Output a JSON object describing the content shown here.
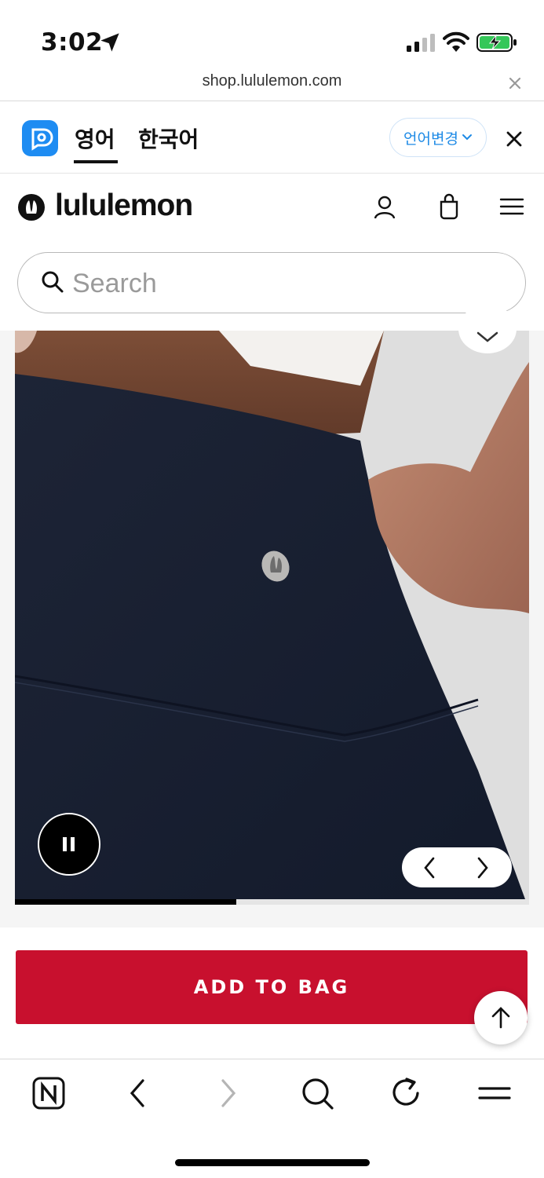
{
  "status_bar": {
    "time": "3:02"
  },
  "browser": {
    "url": "shop.lululemon.com"
  },
  "translate_bar": {
    "source_lang": "영어",
    "target_lang": "한국어",
    "change_lang_label": "언어변경"
  },
  "site_header": {
    "brand": "lululemon",
    "search_placeholder": "Search"
  },
  "gallery": {
    "progress_fraction": 0.43
  },
  "cta": {
    "add_to_bag_label": "ADD TO BAG"
  },
  "colors": {
    "brand_red": "#c8102e",
    "translate_blue": "#1d8ae6",
    "navy_product": "#1b2233"
  },
  "icons": [
    "location-arrow-icon",
    "signal-icon",
    "wifi-icon",
    "battery-icon",
    "close-icon",
    "papago-icon",
    "chevron-down-icon",
    "lululemon-logo-icon",
    "account-icon",
    "shopping-bag-icon",
    "hamburger-menu-icon",
    "search-icon",
    "heart-icon",
    "pause-icon",
    "chevron-left-icon",
    "chevron-right-icon",
    "arrow-up-icon",
    "naver-icon",
    "back-icon",
    "forward-icon",
    "refresh-icon"
  ]
}
